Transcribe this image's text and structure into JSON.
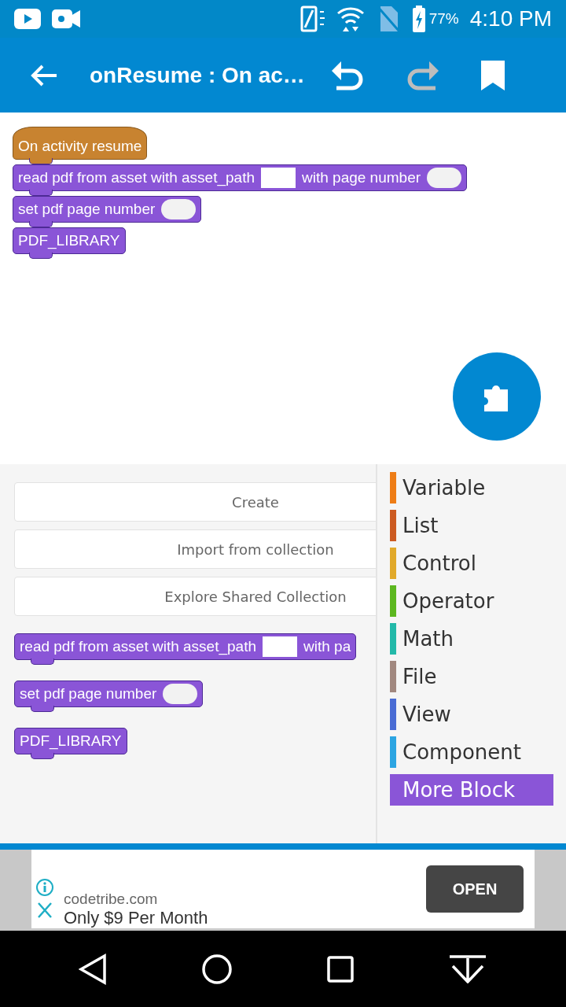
{
  "status_bar": {
    "battery": "77%",
    "time": "4:10 PM"
  },
  "app_bar": {
    "title": "onResume : On ac…"
  },
  "canvas": {
    "blocks": [
      {
        "kind": "hat",
        "parts": [
          {
            "kind": "text",
            "text": "On activity resume"
          }
        ]
      },
      {
        "kind": "stack",
        "parts": [
          {
            "kind": "text",
            "text": "read pdf from asset with asset_path"
          },
          {
            "kind": "string_slot"
          },
          {
            "kind": "text",
            "text": "with page number"
          },
          {
            "kind": "number_slot"
          }
        ]
      },
      {
        "kind": "stack",
        "parts": [
          {
            "kind": "text",
            "text": "set pdf page number"
          },
          {
            "kind": "number_slot"
          }
        ]
      },
      {
        "kind": "stack",
        "parts": [
          {
            "kind": "text",
            "text": "PDF_LIBRARY"
          }
        ]
      }
    ]
  },
  "palette": {
    "buttons": [
      "Create",
      "Import from collection",
      "Explore Shared Collection"
    ],
    "blocks": [
      {
        "kind": "stack",
        "parts": [
          {
            "kind": "text",
            "text": "read pdf from asset with asset_path"
          },
          {
            "kind": "string_slot"
          },
          {
            "kind": "text",
            "text": "with pa"
          }
        ]
      },
      {
        "kind": "stack",
        "parts": [
          {
            "kind": "text",
            "text": "set pdf page number"
          },
          {
            "kind": "number_slot"
          }
        ]
      },
      {
        "kind": "stack",
        "parts": [
          {
            "kind": "text",
            "text": "PDF_LIBRARY"
          }
        ]
      }
    ]
  },
  "categories": [
    {
      "name": "Variable",
      "color": "#ee7d16",
      "selected": false
    },
    {
      "name": "List",
      "color": "#cc5b22",
      "selected": false
    },
    {
      "name": "Control",
      "color": "#e1a92a",
      "selected": false
    },
    {
      "name": "Operator",
      "color": "#5cb71f",
      "selected": false
    },
    {
      "name": "Math",
      "color": "#23b9a9",
      "selected": false
    },
    {
      "name": "File",
      "color": "#a1887f",
      "selected": false
    },
    {
      "name": "View",
      "color": "#4a6cd4",
      "selected": false
    },
    {
      "name": "Component",
      "color": "#2ca5e2",
      "selected": false
    },
    {
      "name": "More Block",
      "color": "#8a55d7",
      "selected": true
    }
  ],
  "ad": {
    "domain": "codetribe.com",
    "headline": "Only $9 Per Month",
    "button": "OPEN"
  }
}
